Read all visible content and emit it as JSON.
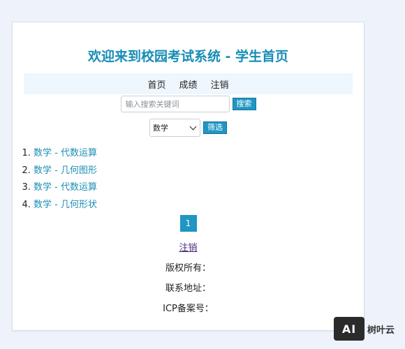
{
  "page": {
    "title": "欢迎来到校园考试系统 - 学生首页"
  },
  "nav": {
    "items": [
      "首页",
      "成绩",
      "注销"
    ]
  },
  "search": {
    "placeholder": "输入搜索关键词",
    "button_label": "搜索"
  },
  "filter": {
    "selected_subject": "数学",
    "button_label": "筛选"
  },
  "exams": [
    "数学 - 代数运算",
    "数学 - 几何图形",
    "数学 - 代数运算",
    "数学 - 几何形状"
  ],
  "pagination": {
    "current_page": "1"
  },
  "logout": {
    "label": "注销"
  },
  "footer": {
    "copyright": "版权所有：",
    "contact": "联系地址：",
    "icp": "ICP备案号："
  },
  "watermark": {
    "logo": "AI",
    "brand": "树叶云"
  },
  "colors": {
    "accent": "#1f96c3",
    "title": "#168db6",
    "link": "#1b8fb3",
    "visited_link": "#4b2a7a"
  }
}
